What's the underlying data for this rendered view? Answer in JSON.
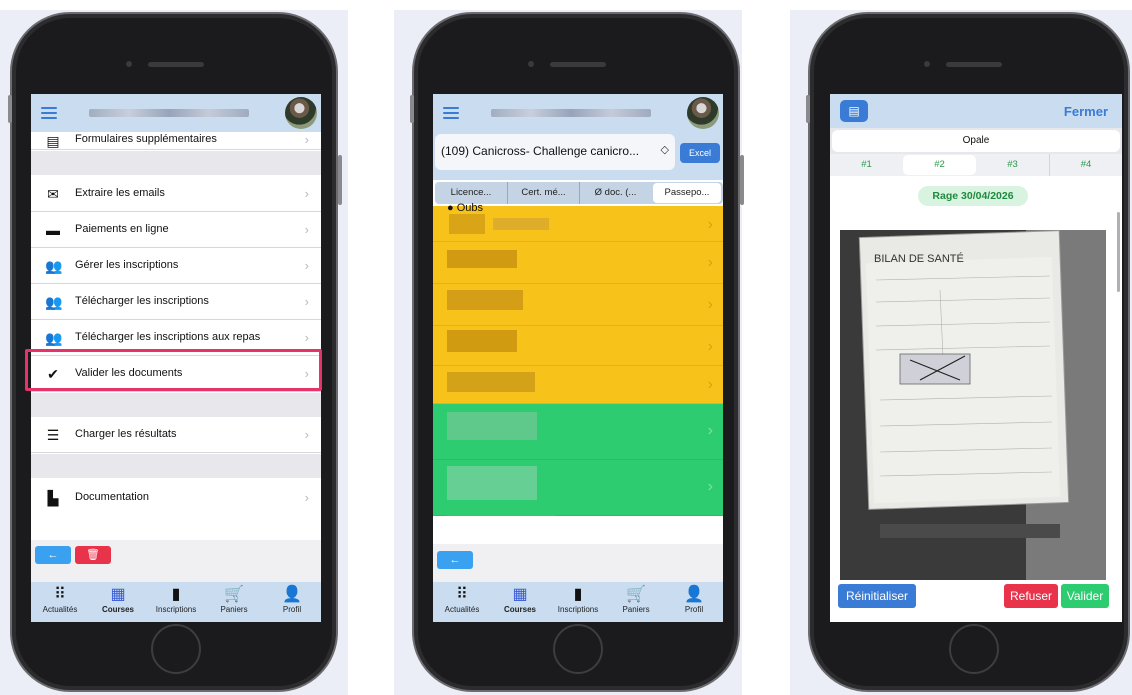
{
  "phone1": {
    "menu": [
      {
        "icon": "form-icon",
        "label": "Formulaires supplémentaires"
      },
      {
        "icon": "envelope-icon",
        "label": "Extraire les emails"
      },
      {
        "icon": "credit-card-icon",
        "label": "Paiements en ligne"
      },
      {
        "icon": "users-icon",
        "label": "Gérer les inscriptions"
      },
      {
        "icon": "users-icon",
        "label": "Télécharger les inscriptions"
      },
      {
        "icon": "users-icon",
        "label": "Télécharger les inscriptions aux repas"
      },
      {
        "icon": "check-circle-icon",
        "label": "Valider les documents"
      },
      {
        "icon": "list-icon",
        "label": "Charger les résultats"
      },
      {
        "icon": "document-icon",
        "label": "Documentation"
      }
    ],
    "back_glyph": "←",
    "trash_glyph": "🗑"
  },
  "phone2": {
    "select_value": "(109) Canicross- Challenge canicro...",
    "select_arrow": "◇",
    "excel_label": "Excel",
    "segments": [
      "Licence...",
      "Cert. mé...",
      "Ø doc. (...",
      "Passepo..."
    ],
    "first_row_label": "● Oubs",
    "back_glyph": "←"
  },
  "phone3": {
    "fermer_label": "Fermer",
    "name": "Opale",
    "doc_tabs": [
      "#1",
      "#2",
      "#3",
      "#4"
    ],
    "active_doc_tab": 1,
    "badge": "Rage 30/04/2026",
    "doc_title": "BILAN DE SANTÉ",
    "reset_label": "Réinitialiser",
    "refuse_label": "Refuser",
    "validate_label": "Valider"
  },
  "tabbar": [
    {
      "icon": "grid-icon",
      "glyph": "⠿",
      "label": "Actualités"
    },
    {
      "icon": "calendar-icon",
      "glyph": "▦",
      "label": "Courses"
    },
    {
      "icon": "bar-chart-icon",
      "glyph": "▮",
      "label": "Inscriptions"
    },
    {
      "icon": "cart-icon",
      "glyph": "🛒",
      "label": "Paniers"
    },
    {
      "icon": "person-icon",
      "glyph": "👤",
      "label": "Profil"
    }
  ],
  "colors": {
    "header_bg": "#c9dcf0",
    "accent": "#3a7bd5",
    "highlight_border": "#e8336a",
    "yellow_row": "#f7c21a",
    "green_row": "#2ecc71",
    "danger": "#e8334a",
    "success": "#2ecc71"
  }
}
